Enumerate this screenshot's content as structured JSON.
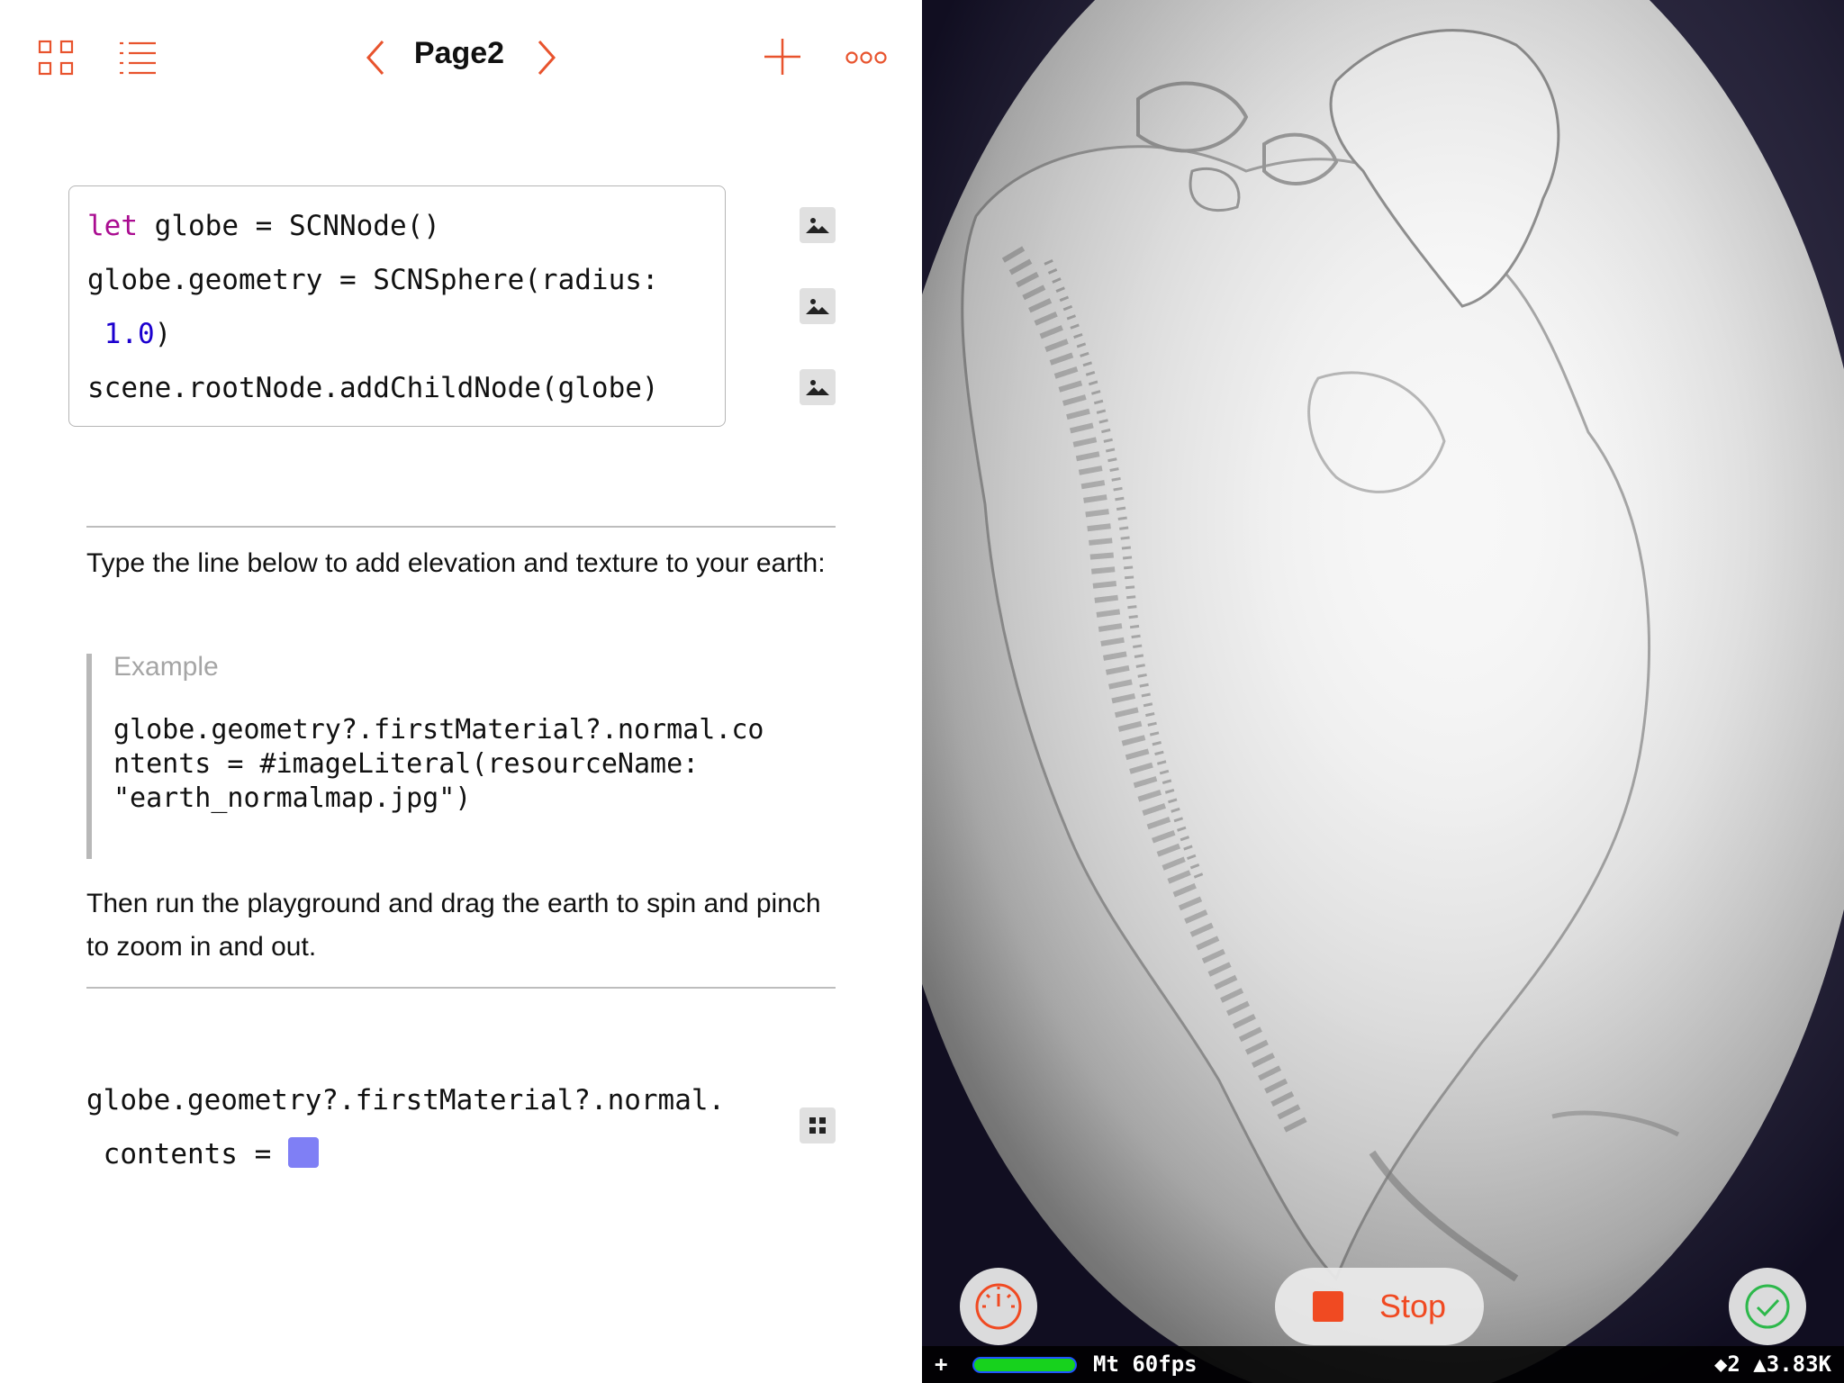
{
  "toolbar": {
    "page_title": "Page2",
    "icons": [
      "grid-icon",
      "list-icon",
      "chevron-left-icon",
      "chevron-right-icon",
      "plus-icon",
      "more-icon"
    ]
  },
  "code_block": {
    "line1_kw": "let",
    "line1_rest": " globe = SCNNode()",
    "line2": "globe.geometry = SCNSphere(radius:",
    "line3_num": "1.0",
    "line3_rest": ")",
    "line4": "scene.rootNode.addChildNode(globe)"
  },
  "instructions": {
    "intro": "Type the line below to add elevation and texture to your earth:",
    "example_label": "Example",
    "example_code": "globe.geometry?.firstMaterial?.normal.co\nntents = #imageLiteral(resourceName:\n\"earth_normalmap.jpg\")",
    "outro": "Then run the playground and drag the earth to spin and pinch to zoom in and out."
  },
  "edit_line": {
    "line1": "globe.geometry?.firstMaterial?.normal.",
    "line2": " contents = ",
    "color_literal": "#7f7ff5"
  },
  "live_view": {
    "stop_label": "Stop",
    "accent": "#f04a22",
    "success": "#2db84b"
  },
  "stats_bar": {
    "plus": "+",
    "fps": "Mt 60fps",
    "counts": "◆2 ▲3.83K"
  }
}
